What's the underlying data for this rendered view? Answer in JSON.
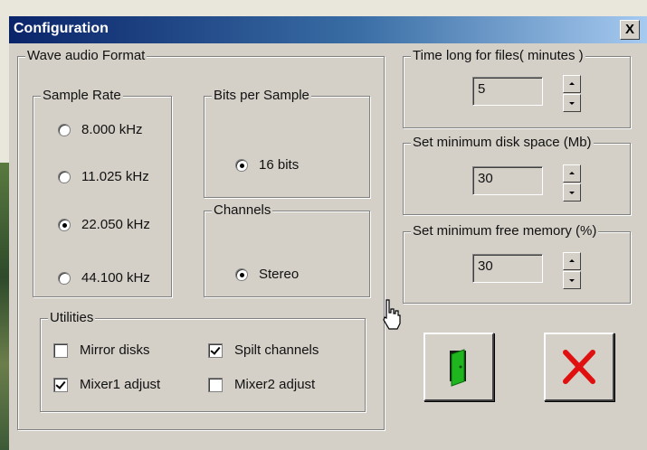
{
  "dialog": {
    "title": "Configuration",
    "close_label": "X"
  },
  "wave_format": {
    "legend": "Wave audio Format",
    "sample_rate": {
      "legend": "Sample Rate",
      "options": [
        "8.000 kHz",
        "11.025 kHz",
        "22.050 kHz",
        "44.100 kHz"
      ],
      "selected": "22.050 kHz"
    },
    "bits_per_sample": {
      "legend": "Bits per Sample",
      "option": "16 bits",
      "selected": true
    },
    "channels": {
      "legend": "Channels",
      "option": "Stereo",
      "selected": true
    }
  },
  "utilities": {
    "legend": "Utilities",
    "mirror_disks": {
      "label": "Mirror disks",
      "checked": false
    },
    "split_channels": {
      "label": "Spilt channels",
      "checked": true
    },
    "mixer1_adjust": {
      "label": "Mixer1 adjust",
      "checked": true
    },
    "mixer2_adjust": {
      "label": "Mixer2 adjust",
      "checked": false
    }
  },
  "time_long": {
    "legend": "Time long for files( minutes )",
    "value": "5"
  },
  "min_disk": {
    "legend": "Set minimum disk space (Mb)",
    "value": "30"
  },
  "min_memory": {
    "legend": "Set minimum free memory (%)",
    "value": "30"
  },
  "buttons": {
    "ok_icon": "door-exit-icon",
    "cancel_icon": "red-x-icon"
  },
  "colors": {
    "title_bar": "#0a246a",
    "door_green": "#1fb51f",
    "cancel_red": "#e01010",
    "face": "#d4d0c8"
  }
}
